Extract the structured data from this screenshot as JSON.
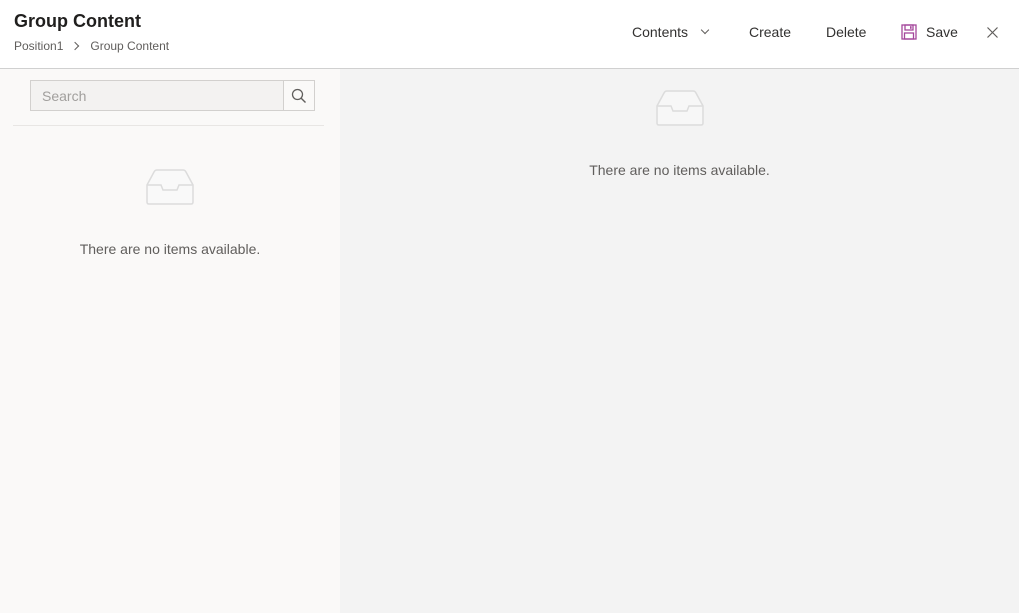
{
  "header": {
    "title": "Group Content",
    "breadcrumb": [
      "Position1",
      "Group Content"
    ]
  },
  "toolbar": {
    "contents_label": "Contents",
    "create_label": "Create",
    "delete_label": "Delete",
    "save_label": "Save",
    "close_icon": "close-icon",
    "save_icon": "save-icon",
    "save_icon_color": "#a4479b"
  },
  "left_pane": {
    "search_placeholder": "Search",
    "empty_message": "There are no items available."
  },
  "right_pane": {
    "empty_message": "There are no items available."
  }
}
